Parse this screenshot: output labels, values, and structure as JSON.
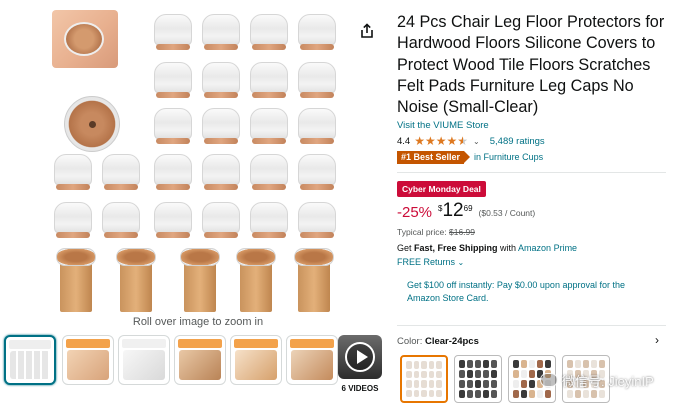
{
  "product": {
    "title": "24 Pcs Chair Leg Floor Protectors for Hardwood Floors Silicone Covers to Protect Wood Tile Floors Scratches Felt Pads Furniture Leg Caps No Noise (Small-Clear)",
    "store_link": "Visit the VIUME Store",
    "rating_value": "4.4",
    "rating_stars": 4.4,
    "rating_count": "5,489 ratings",
    "bestseller_badge": "#1 Best Seller",
    "bestseller_category": "in Furniture Cups"
  },
  "gallery": {
    "zoom_hint": "Roll over image to zoom in",
    "videos_label": "6 VIDEOS",
    "thumbnail_count": 6
  },
  "pricing": {
    "deal_badge": "Cyber Monday Deal",
    "discount": "-25%",
    "currency": "$",
    "price_whole": "12",
    "price_fraction": "69",
    "unit_price": "($0.53 / Count)",
    "typical_label": "Typical price:",
    "typical_price": "$16.99"
  },
  "shipping": {
    "prefix": "Get ",
    "highlight": "Fast, Free Shipping",
    "middle": " with ",
    "prime_link": "Amazon Prime",
    "returns": "FREE Returns"
  },
  "promo": {
    "text": "Get $100 off instantly: Pay $0.00 upon approval for the Amazon Store Card."
  },
  "variant": {
    "label": "Color: ",
    "selected": "Clear-24pcs"
  },
  "watermark": {
    "text": "微信号: JieyinIP"
  },
  "colors": {
    "link": "#007185",
    "deal_red": "#cc0c39",
    "bestseller_orange": "#c45500",
    "star": "#de7921",
    "selected_thumb": "#007185",
    "selected_swatch": "#e77600"
  },
  "icons": {
    "share": "share-icon",
    "play": "play-icon",
    "chevron": "chevron-down-icon"
  }
}
